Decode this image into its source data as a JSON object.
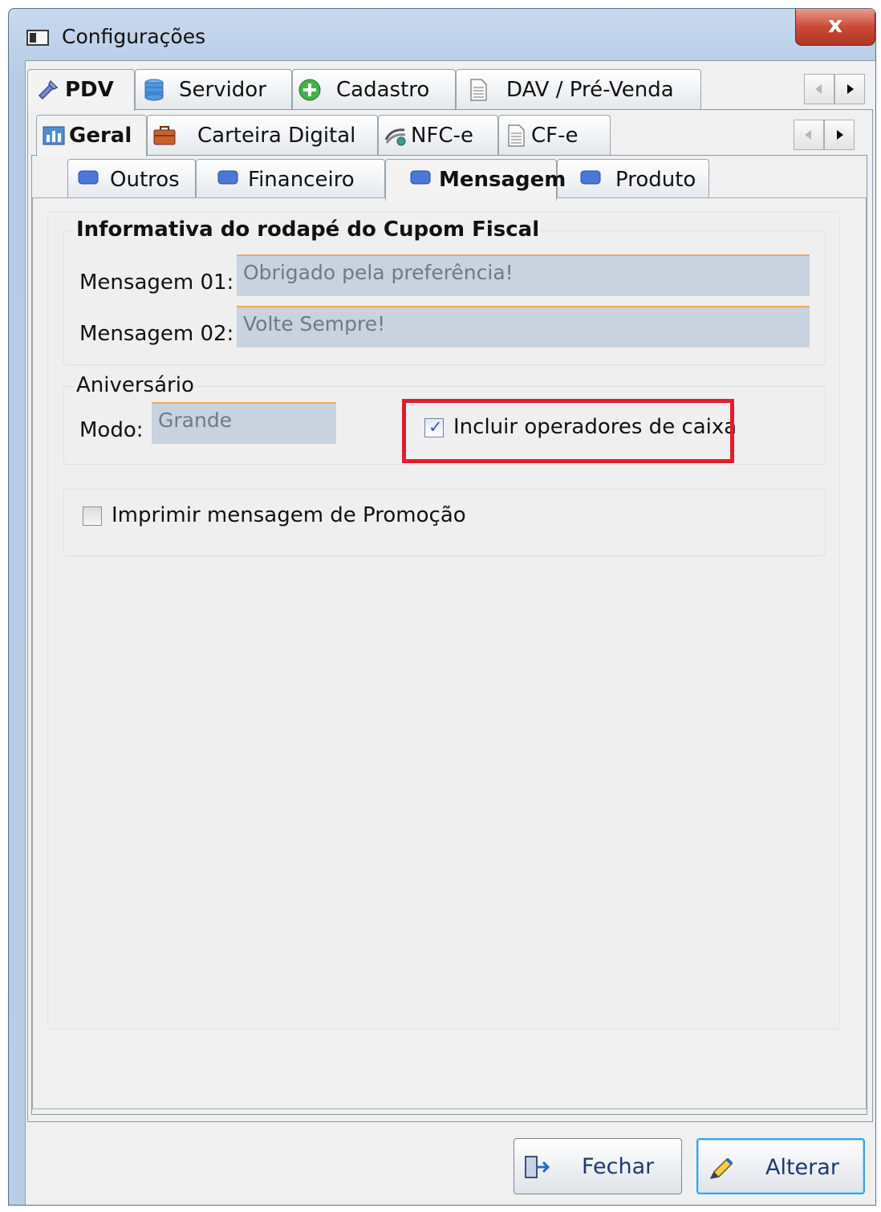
{
  "window": {
    "title": "Configurações",
    "close_glyph": "x"
  },
  "tabs_level1": [
    {
      "label": "PDV",
      "icon": "tools-icon",
      "active": true
    },
    {
      "label": "Servidor",
      "icon": "database-icon"
    },
    {
      "label": "Cadastro",
      "icon": "plus-circle-icon"
    },
    {
      "label": "DAV / Pré-Venda",
      "icon": "document-icon"
    }
  ],
  "tabs_level2": [
    {
      "label": "Geral",
      "icon": "chart-icon",
      "active": true
    },
    {
      "label": "Carteira Digital",
      "icon": "briefcase-icon"
    },
    {
      "label": "NFC-e",
      "icon": "coins-icon"
    },
    {
      "label": "CF-e",
      "icon": "document-icon"
    }
  ],
  "tabs_level3": [
    {
      "label": "Outros",
      "icon": "blue-rect-icon"
    },
    {
      "label": "Financeiro",
      "icon": "blue-rect-icon"
    },
    {
      "label": "Mensagem",
      "icon": "blue-rect-icon",
      "active": true
    },
    {
      "label": "Produto",
      "icon": "blue-rect-icon"
    }
  ],
  "footer_group": {
    "title": "Informativa do rodapé do Cupom Fiscal",
    "msg1_label": "Mensagem 01:",
    "msg1_value": "Obrigado pela preferência!",
    "msg2_label": "Mensagem 02:",
    "msg2_value": "Volte Sempre!"
  },
  "birthday_group": {
    "title": "Aniversário",
    "mode_label": "Modo:",
    "mode_value": "Grande",
    "include_cashiers_label": "Incluir operadores de caixa",
    "include_cashiers_checked": true
  },
  "promo": {
    "label": "Imprimir mensagem de Promoção",
    "checked": false
  },
  "buttons": {
    "close": "Fechar",
    "change": "Alterar"
  },
  "colors": {
    "highlight": "#e31d2b",
    "edit_bg": "#c8d3df",
    "edit_accent": "#f2a75a",
    "default_button": "#3ca2e3"
  }
}
